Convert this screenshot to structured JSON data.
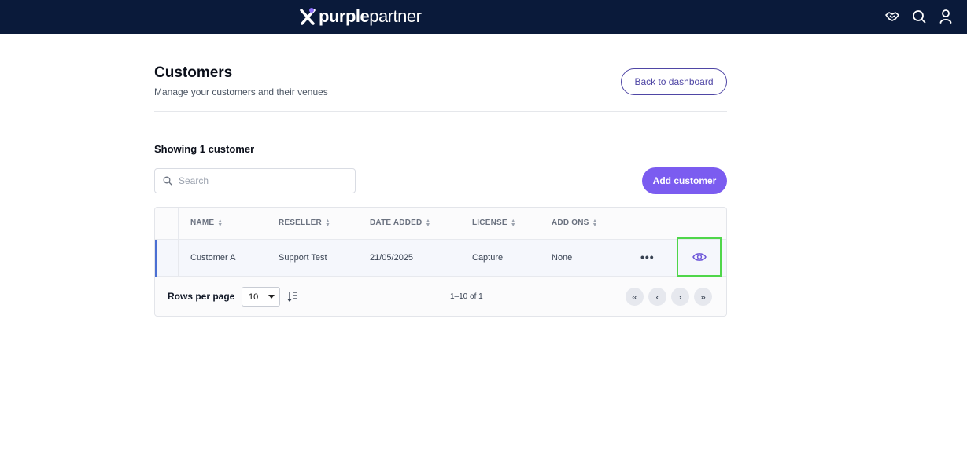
{
  "app": {
    "brand_bold": "purple",
    "brand_light": "partner"
  },
  "topbar_icons": [
    "handshake-icon",
    "search-icon",
    "user-icon"
  ],
  "header": {
    "title": "Customers",
    "subtitle": "Manage your customers and their venues",
    "back_label": "Back to dashboard"
  },
  "list": {
    "showing": "Showing 1 customer",
    "search_placeholder": "Search",
    "add_label": "Add customer"
  },
  "table": {
    "columns": [
      "NAME",
      "RESELLER",
      "DATE ADDED",
      "LICENSE",
      "ADD ONS"
    ],
    "rows": [
      {
        "name": "Customer A",
        "reseller": "Support Test",
        "date_added": "21/05/2025",
        "license": "Capture",
        "add_ons": "None"
      }
    ],
    "more_glyph": "•••"
  },
  "footer": {
    "rows_per_page_label": "Rows per page",
    "rows_per_page_value": "10",
    "range": "1–10 of 1",
    "pager": [
      "«",
      "‹",
      "›",
      "»"
    ]
  },
  "colors": {
    "topbar": "#0a1a3a",
    "accent_purple": "#7b5cf0",
    "outline_purple": "#4f46a5",
    "row_accent": "#4a6fd3",
    "highlight_green": "#4fd64a"
  }
}
